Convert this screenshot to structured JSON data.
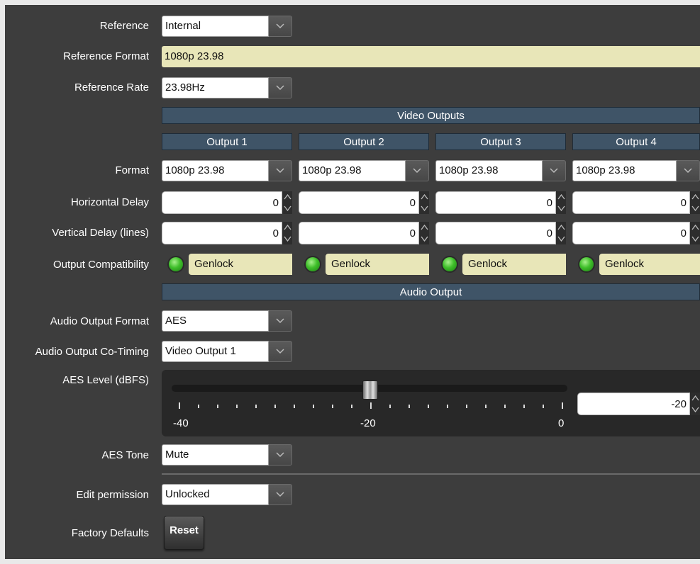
{
  "labels": {
    "reference": "Reference",
    "reference_format": "Reference Format",
    "reference_rate": "Reference Rate",
    "format": "Format",
    "horizontal_delay": "Horizontal Delay",
    "vertical_delay": "Vertical Delay (lines)",
    "output_compatibility": "Output Compatibility",
    "audio_output_format": "Audio Output Format",
    "audio_output_cotiming": "Audio Output Co-Timing",
    "aes_level": "AES Level (dBFS)",
    "aes_tone": "AES Tone",
    "edit_permission": "Edit permission",
    "factory_defaults": "Factory Defaults"
  },
  "reference": {
    "value": "Internal"
  },
  "reference_format": {
    "value": "1080p 23.98"
  },
  "reference_rate": {
    "value": "23.98Hz"
  },
  "video_outputs": {
    "header": "Video Outputs",
    "outputs": [
      {
        "name": "Output 1",
        "format": "1080p 23.98",
        "h_delay": "0",
        "v_delay": "0",
        "compat": "Genlock"
      },
      {
        "name": "Output 2",
        "format": "1080p 23.98",
        "h_delay": "0",
        "v_delay": "0",
        "compat": "Genlock"
      },
      {
        "name": "Output 3",
        "format": "1080p 23.98",
        "h_delay": "0",
        "v_delay": "0",
        "compat": "Genlock"
      },
      {
        "name": "Output 4",
        "format": "1080p 23.98",
        "h_delay": "0",
        "v_delay": "0",
        "compat": "Genlock"
      }
    ]
  },
  "audio_output": {
    "header": "Audio Output",
    "format": "AES",
    "cotiming": "Video Output 1",
    "aes_level": {
      "value": "-20",
      "min": -40,
      "max": 0,
      "current": -20,
      "tick_labels": [
        "-40",
        "-20",
        "0"
      ]
    },
    "aes_tone": "Mute"
  },
  "edit_permission": {
    "value": "Unlocked"
  },
  "factory_defaults": {
    "button_label": "Reset"
  },
  "colors": {
    "panel_bg": "#3d3d3d",
    "header_bg": "#3f5467",
    "readonly_bg": "#e8e6b8",
    "led_green": "#3fbf2a"
  }
}
